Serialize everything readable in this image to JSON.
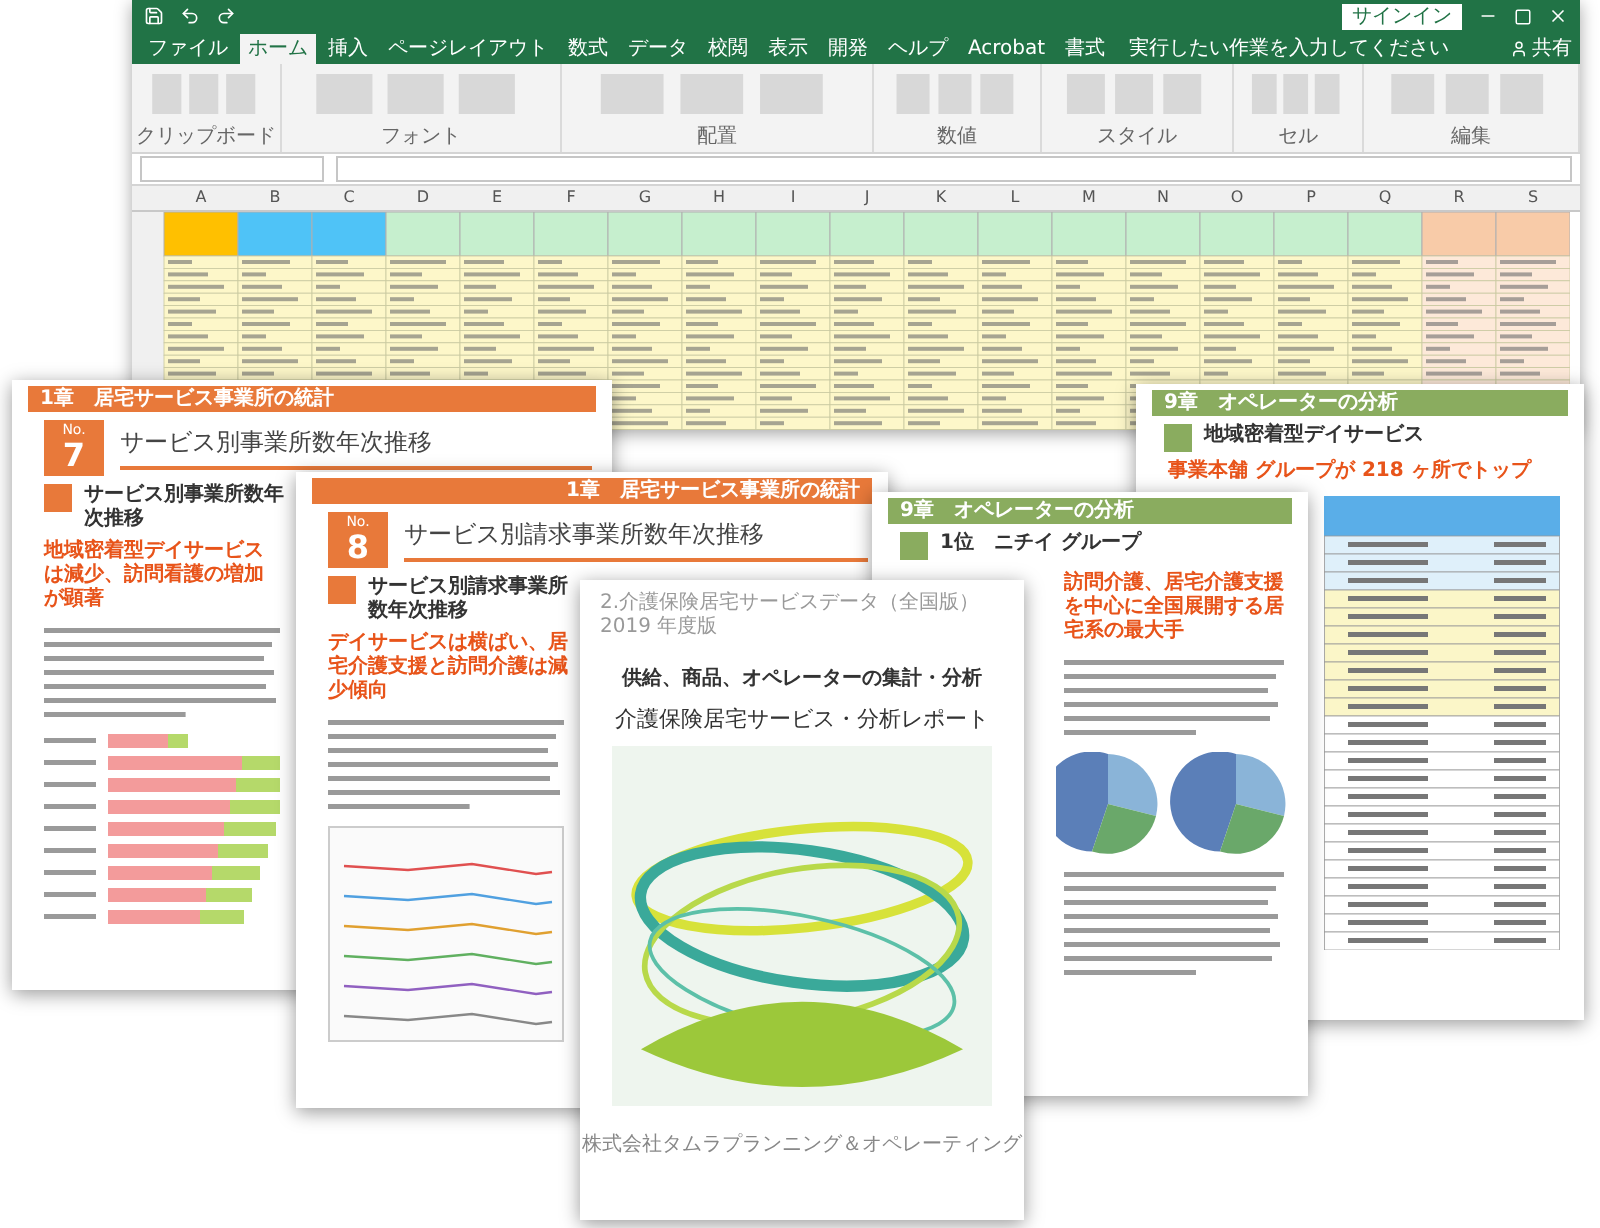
{
  "excel": {
    "tabs": [
      {
        "label": "ファイル",
        "selected": false
      },
      {
        "label": "ホーム",
        "selected": true
      },
      {
        "label": "挿入",
        "selected": false
      },
      {
        "label": "ページレイアウト",
        "selected": false
      },
      {
        "label": "数式",
        "selected": false
      },
      {
        "label": "データ",
        "selected": false
      },
      {
        "label": "校閲",
        "selected": false
      },
      {
        "label": "表示",
        "selected": false
      },
      {
        "label": "開発",
        "selected": false
      },
      {
        "label": "ヘルプ",
        "selected": false
      },
      {
        "label": "Acrobat",
        "selected": false
      },
      {
        "label": "書式",
        "selected": false
      }
    ],
    "tell_me": "実行したい作業を入力してください",
    "sign_in": "サインイン",
    "share": "共有",
    "ribbon_groups": [
      "クリップボード",
      "フォント",
      "配置",
      "数値",
      "スタイル",
      "セル",
      "編集"
    ],
    "columns": [
      "A",
      "B",
      "C",
      "D",
      "E",
      "F",
      "G",
      "H",
      "I",
      "J",
      "K",
      "L",
      "M",
      "N",
      "O",
      "P",
      "Q",
      "R",
      "S"
    ]
  },
  "pages": [
    {
      "kind": "chapter",
      "chapter": "1章　居宅サービス事業所の統計",
      "number_label": "No.",
      "number": "7",
      "title": "サービス別事業所数年次推移",
      "section": "サービス別事業所数年次推移",
      "headline": "地域密着型デイサービスは減少、訪問看護の増加が顕著"
    },
    {
      "kind": "operator",
      "chapter": "9章　オペレーターの分析",
      "section": "地域密着型デイサービス",
      "headline": "事業本舗 グループが 218 ヶ所でトップ"
    },
    {
      "kind": "chapter",
      "chapter": "1章　居宅サービス事業所の統計",
      "number_label": "No.",
      "number": "8",
      "title": "サービス別請求事業所数年次推移",
      "section": "サービス別請求事業所数年次推移",
      "headline": "デイサービスは横ばい、居宅介護支援と訪問介護は減少傾向"
    },
    {
      "kind": "operator",
      "chapter": "9章　オペレーターの分析",
      "section": "1位　ニチイ グループ",
      "headline": "訪問介護、居宅介護支援を中心に全国展開する居宅系の最大手"
    },
    {
      "kind": "cover",
      "series": "2.介護保険居宅サービスデータ（全国版）　2019 年度版",
      "subtitle": "供給、商品、オペレーターの集計・分析",
      "title": "介護保険居宅サービス・分析レポート",
      "publisher": "株式会社タムラプランニング＆オペレーティング"
    }
  ]
}
